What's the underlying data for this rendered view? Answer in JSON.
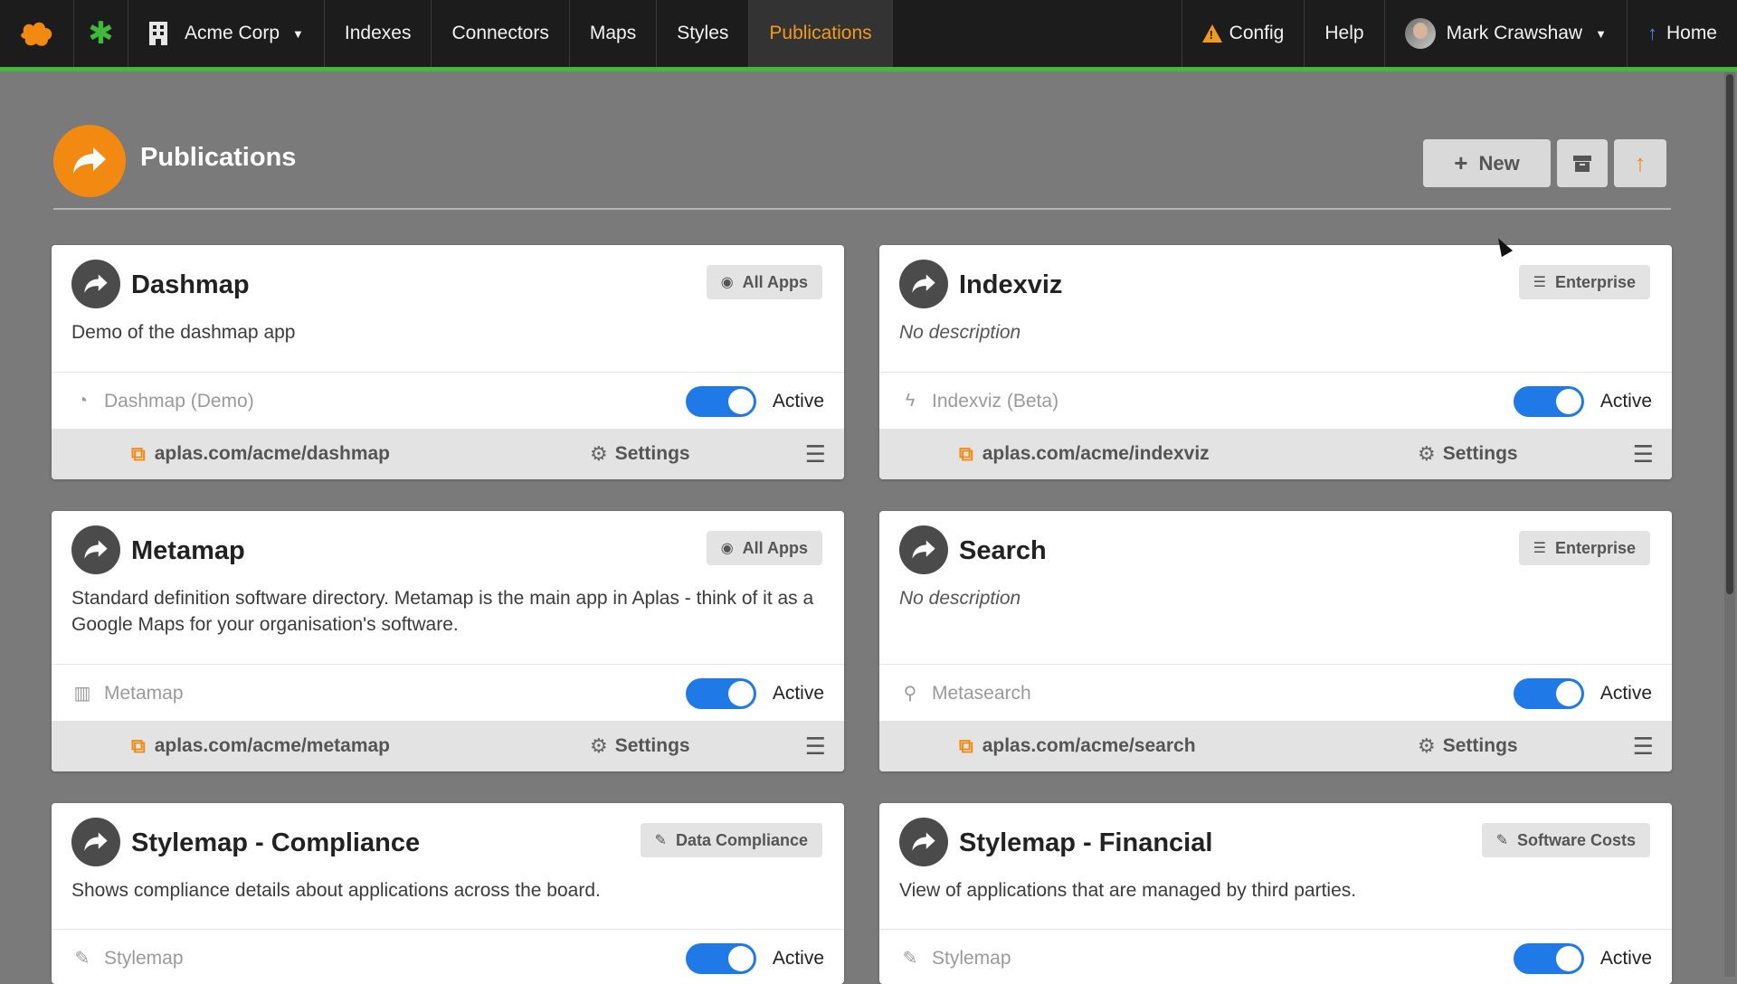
{
  "navbar": {
    "org": "Acme Corp",
    "items": [
      "Indexes",
      "Connectors",
      "Maps",
      "Styles",
      "Publications"
    ],
    "active": "Publications",
    "config": "Config",
    "help": "Help",
    "user": "Mark Crawshaw",
    "home": "Home",
    "accent": "#3fba3a"
  },
  "header": {
    "title": "Publications",
    "new_label": "New",
    "icon_color": "#f28a12"
  },
  "cards": [
    {
      "title": "Dashmap",
      "badge": "All Apps",
      "badge_icon": "compass-icon",
      "description": "Demo of the dashmap app",
      "app": "Dashmap (Demo)",
      "app_icon": "dashboard-icon",
      "status": "Active",
      "link": "aplas.com/acme/dashmap",
      "settings": "Settings"
    },
    {
      "title": "Indexviz",
      "badge": "Enterprise",
      "badge_icon": "database-icon",
      "description": "No description",
      "app": "Indexviz (Beta)",
      "app_icon": "bolt-icon",
      "status": "Active",
      "link": "aplas.com/acme/indexviz",
      "settings": "Settings"
    },
    {
      "title": "Metamap",
      "badge": "All Apps",
      "badge_icon": "compass-icon",
      "description": "Standard definition software directory. Metamap is the main app in Aplas - think of it as a Google Maps for your organisation's software.",
      "app": "Metamap",
      "app_icon": "map-icon",
      "status": "Active",
      "link": "aplas.com/acme/metamap",
      "settings": "Settings"
    },
    {
      "title": "Search",
      "badge": "Enterprise",
      "badge_icon": "database-icon",
      "description": "No description",
      "app": "Metasearch",
      "app_icon": "search-icon",
      "status": "Active",
      "link": "aplas.com/acme/search",
      "settings": "Settings"
    },
    {
      "title": "Stylemap - Compliance",
      "badge": "Data Compliance",
      "badge_icon": "brush-icon",
      "description": "Shows compliance details about applications across the board.",
      "app": "Stylemap",
      "app_icon": "brush-icon",
      "status": "Active"
    },
    {
      "title": "Stylemap - Financial",
      "badge": "Software Costs",
      "badge_icon": "brush-icon",
      "description": "View of applications that are managed by third parties.",
      "app": "Stylemap",
      "app_icon": "brush-icon",
      "status": "Active"
    }
  ]
}
